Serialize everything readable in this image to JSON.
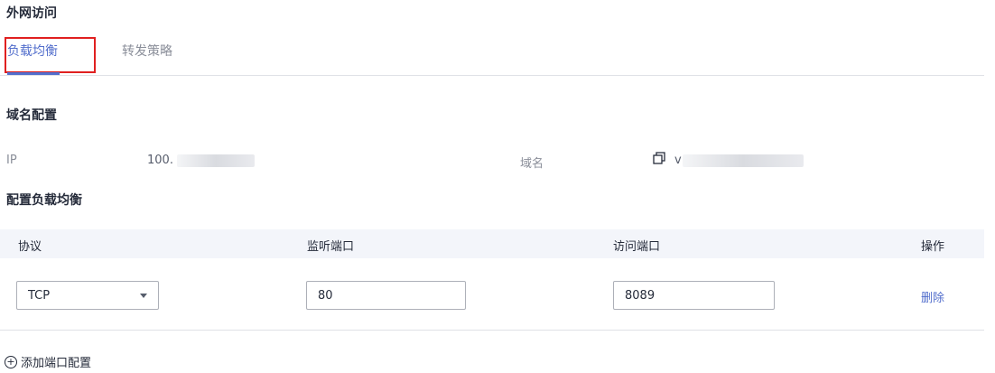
{
  "page_title": "外网访问",
  "tabs": [
    {
      "label": "负载均衡",
      "active": true
    },
    {
      "label": "转发策略",
      "active": false
    }
  ],
  "domain_config": {
    "title": "域名配置",
    "ip_label": "IP",
    "ip_value": "100.",
    "domain_label": "域名",
    "domain_value": "v",
    "copy_icon": "copy-icon"
  },
  "lb_config": {
    "title": "配置负载均衡",
    "columns": [
      "协议",
      "监听端口",
      "访问端口",
      "操作"
    ],
    "rows": [
      {
        "protocol": "TCP",
        "listen_port": "80",
        "access_port": "8089",
        "action": "删除"
      }
    ],
    "add_label": "添加端口配置"
  },
  "colors": {
    "accent": "#526ecc",
    "highlight_border": "#e02020"
  }
}
